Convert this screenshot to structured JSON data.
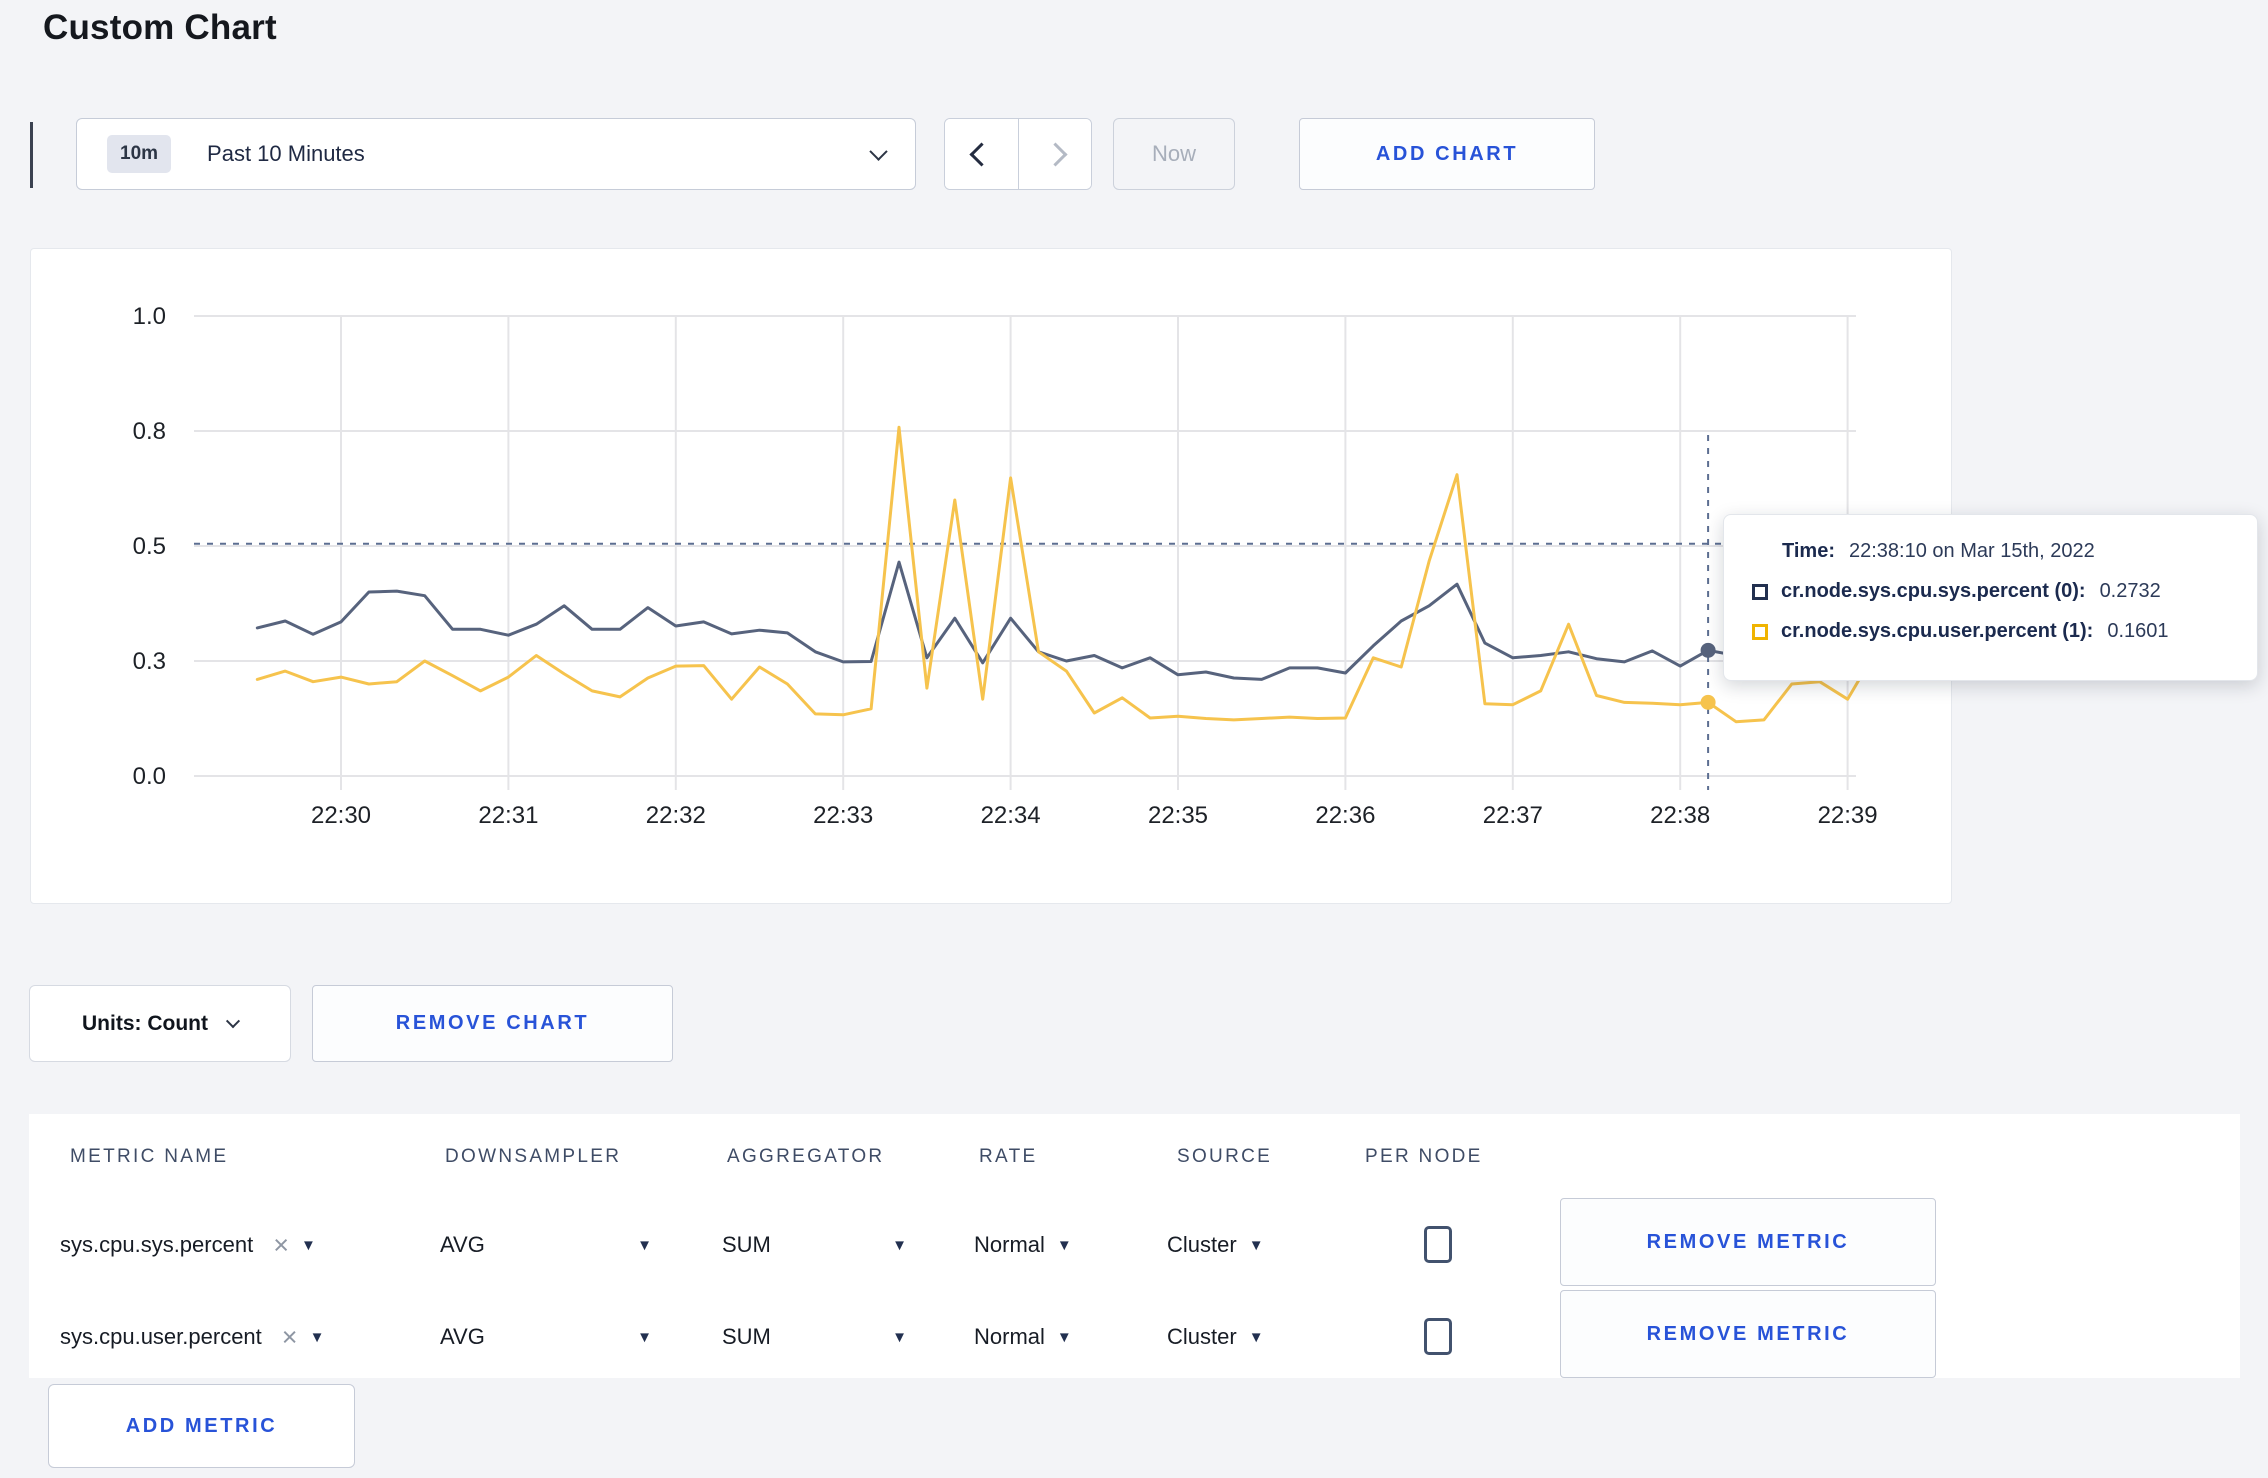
{
  "page": {
    "title": "Custom Chart",
    "background": "#f3f4f7",
    "accent_blue": "#2853d8"
  },
  "icons": {
    "dropdown_arrow": "▼",
    "clear": "×"
  },
  "toolbar": {
    "range_badge": "10m",
    "range_label": "Past 10 Minutes",
    "now_label": "Now",
    "add_chart_label": "ADD CHART"
  },
  "chart_footer": {
    "units_label": "Units: Count",
    "remove_chart_label": "REMOVE CHART"
  },
  "tooltip": {
    "time_label": "Time:",
    "time_value": "22:38:10 on Mar 15th, 2022",
    "series": [
      {
        "label": "cr.node.sys.cpu.sys.percent (0):",
        "value": "0.2732",
        "color": "#22304f"
      },
      {
        "label": "cr.node.sys.cpu.user.percent (1):",
        "value": "0.1601",
        "color": "#f0b400"
      }
    ]
  },
  "chart_data": {
    "type": "line",
    "x_start": "22:29:30",
    "x_interval_seconds": 10,
    "x_ticks": [
      "22:30",
      "22:31",
      "22:32",
      "22:33",
      "22:34",
      "22:35",
      "22:36",
      "22:37",
      "22:38",
      "22:39"
    ],
    "y_ticks": [
      {
        "value": 0,
        "label": "0.0"
      },
      {
        "value": 0.25,
        "label": "0.3"
      },
      {
        "value": 0.5,
        "label": "0.5"
      },
      {
        "value": 0.75,
        "label": "0.8"
      },
      {
        "value": 1,
        "label": "1.0"
      }
    ],
    "ylim": [
      0,
      1
    ],
    "grid": true,
    "crosshair": {
      "time": "22:38:10",
      "index": 52,
      "hline_value": 0.505
    },
    "series": [
      {
        "name": "cr.node.sys.cpu.sys.percent (0)",
        "color": "#57637d",
        "values": [
          0.322,
          0.337,
          0.308,
          0.335,
          0.4,
          0.402,
          0.392,
          0.319,
          0.319,
          0.306,
          0.33,
          0.37,
          0.319,
          0.319,
          0.366,
          0.326,
          0.335,
          0.309,
          0.317,
          0.311,
          0.27,
          0.248,
          0.249,
          0.465,
          0.257,
          0.343,
          0.246,
          0.343,
          0.27,
          0.25,
          0.262,
          0.235,
          0.257,
          0.22,
          0.226,
          0.213,
          0.21,
          0.235,
          0.235,
          0.224,
          0.283,
          0.337,
          0.37,
          0.417,
          0.289,
          0.257,
          0.262,
          0.27,
          0.255,
          0.248,
          0.272,
          0.239,
          0.2732,
          0.262,
          0.27,
          0.268,
          0.272,
          0.265,
          0.268
        ]
      },
      {
        "name": "cr.node.sys.cpu.user.percent (1)",
        "color": "#f6c34d",
        "values": [
          0.21,
          0.228,
          0.205,
          0.215,
          0.2,
          0.205,
          0.25,
          0.218,
          0.185,
          0.215,
          0.262,
          0.222,
          0.185,
          0.172,
          0.213,
          0.239,
          0.24,
          0.167,
          0.237,
          0.2,
          0.135,
          0.133,
          0.146,
          0.758,
          0.191,
          0.6,
          0.167,
          0.648,
          0.27,
          0.228,
          0.137,
          0.17,
          0.126,
          0.13,
          0.125,
          0.122,
          0.125,
          0.128,
          0.125,
          0.126,
          0.257,
          0.237,
          0.467,
          0.655,
          0.157,
          0.155,
          0.185,
          0.33,
          0.175,
          0.16,
          0.158,
          0.155,
          0.1601,
          0.118,
          0.122,
          0.2,
          0.205,
          0.167,
          0.27
        ]
      }
    ]
  },
  "metrics_table": {
    "headers": [
      "METRIC NAME",
      "DOWNSAMPLER",
      "AGGREGATOR",
      "RATE",
      "SOURCE",
      "PER NODE"
    ],
    "rows": [
      {
        "metric": "sys.cpu.sys.percent",
        "downsampler": "AVG",
        "aggregator": "SUM",
        "rate": "Normal",
        "source": "Cluster",
        "per_node": false,
        "remove_label": "REMOVE METRIC"
      },
      {
        "metric": "sys.cpu.user.percent",
        "downsampler": "AVG",
        "aggregator": "SUM",
        "rate": "Normal",
        "source": "Cluster",
        "per_node": false,
        "remove_label": "REMOVE METRIC"
      }
    ],
    "add_metric_label": "ADD METRIC"
  }
}
